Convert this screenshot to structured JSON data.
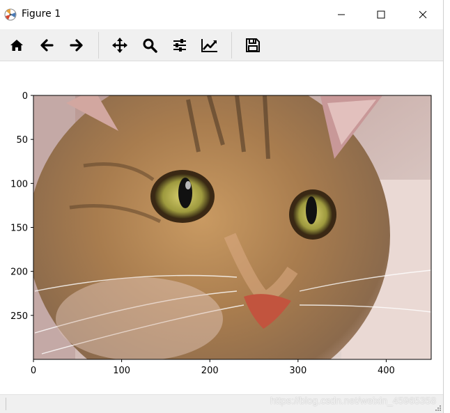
{
  "window": {
    "title": "Figure 1"
  },
  "toolbar": {
    "buttons": [
      {
        "name": "home",
        "icon": "home-icon"
      },
      {
        "name": "back",
        "icon": "arrow-left-icon"
      },
      {
        "name": "forward",
        "icon": "arrow-right-icon"
      },
      {
        "name": "pan",
        "icon": "move-icon"
      },
      {
        "name": "zoom",
        "icon": "zoom-icon"
      },
      {
        "name": "configure-subplots",
        "icon": "sliders-icon"
      },
      {
        "name": "edit-axes",
        "icon": "line-chart-icon"
      },
      {
        "name": "save",
        "icon": "floppy-disk-icon"
      }
    ]
  },
  "axes": {
    "x_ticks": [
      "0",
      "100",
      "200",
      "300",
      "400"
    ],
    "y_ticks": [
      "0",
      "50",
      "100",
      "150",
      "200",
      "250"
    ],
    "x_range": [
      0,
      451
    ],
    "y_range": [
      0,
      300
    ]
  },
  "status": {
    "watermark": "https://blog.csdn.net/weixin_45965358"
  }
}
